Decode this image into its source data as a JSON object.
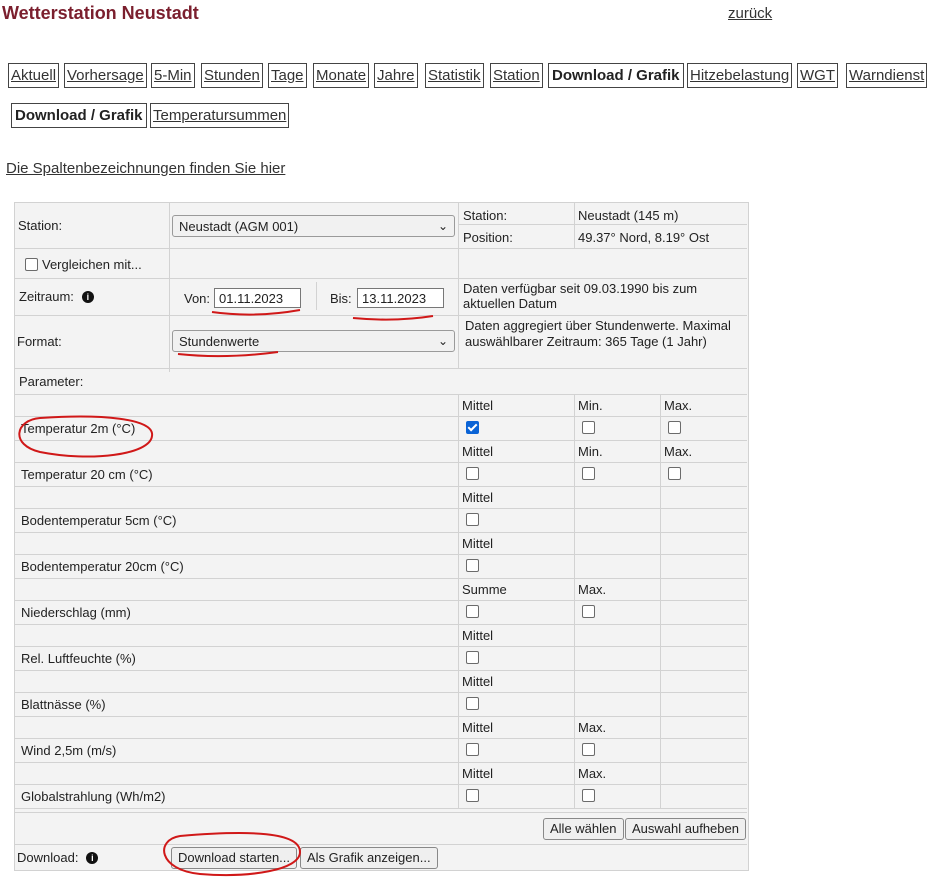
{
  "header": {
    "title": "Wetterstation Neustadt",
    "back_link": "zurück"
  },
  "tabs": [
    "Aktuell",
    "Vorhersage",
    "5-Min",
    "Stunden",
    "Tage",
    "Monate",
    "Jahre",
    "Statistik",
    "Station",
    "Download / Grafik",
    "Hitzebelastung",
    "WGT",
    "Warndienst"
  ],
  "subtabs": [
    "Download / Grafik",
    "Temperatursummen"
  ],
  "legend_link": "Die Spaltenbezeichnungen finden Sie hier",
  "form": {
    "station_label": "Station:",
    "station_value": "Neustadt (AGM 001)",
    "station_info_label": "Station:",
    "station_info_value": "Neustadt (145 m)",
    "position_label": "Position:",
    "position_value": "49.37° Nord, 8.19° Ost",
    "compare_label": "Vergleichen mit...",
    "zeitraum_label": "Zeitraum:",
    "von_label": "Von:",
    "von_value": "01.11.2023",
    "bis_label": "Bis:",
    "bis_value": "13.11.2023",
    "availability": "Daten verfügbar seit 09.03.1990 bis zum aktuellen Datum",
    "format_label": "Format:",
    "format_value": "Stundenwerte",
    "format_info": "Daten aggregiert über Stundenwerte. Maximal auswählbarer Zeitraum: 365 Tage (1 Jahr)",
    "parameter_label": "Parameter:"
  },
  "parameters": [
    {
      "name": "Temperatur 2m (°C)",
      "cols": [
        "Mittel",
        "Min.",
        "Max."
      ],
      "checked": [
        true,
        false,
        false
      ]
    },
    {
      "name": "Temperatur 20 cm (°C)",
      "cols": [
        "Mittel",
        "Min.",
        "Max."
      ],
      "checked": [
        false,
        false,
        false
      ]
    },
    {
      "name": "Bodentemperatur 5cm (°C)",
      "cols": [
        "Mittel"
      ],
      "checked": [
        false
      ]
    },
    {
      "name": "Bodentemperatur 20cm (°C)",
      "cols": [
        "Mittel"
      ],
      "checked": [
        false
      ]
    },
    {
      "name": "Niederschlag (mm)",
      "cols": [
        "Summe",
        "Max."
      ],
      "checked": [
        false,
        false
      ]
    },
    {
      "name": "Rel. Luftfeuchte (%)",
      "cols": [
        "Mittel"
      ],
      "checked": [
        false
      ]
    },
    {
      "name": "Blattnässe (%)",
      "cols": [
        "Mittel"
      ],
      "checked": [
        false
      ]
    },
    {
      "name": "Wind 2,5m (m/s)",
      "cols": [
        "Mittel",
        "Max."
      ],
      "checked": [
        false,
        false
      ]
    },
    {
      "name": "Globalstrahlung (Wh/m2)",
      "cols": [
        "Mittel",
        "Max."
      ],
      "checked": [
        false,
        false
      ]
    }
  ],
  "buttons": {
    "select_all": "Alle wählen",
    "deselect": "Auswahl aufheben",
    "download_label": "Download:",
    "download_start": "Download starten...",
    "as_chart": "Als Grafik anzeigen..."
  },
  "colors": {
    "title": "#7b1f2e",
    "annotation": "#d01818",
    "checkbox_checked": "#0a63d6"
  },
  "icons": {
    "info": "info-icon",
    "dropdown": "chevron-down-icon"
  }
}
